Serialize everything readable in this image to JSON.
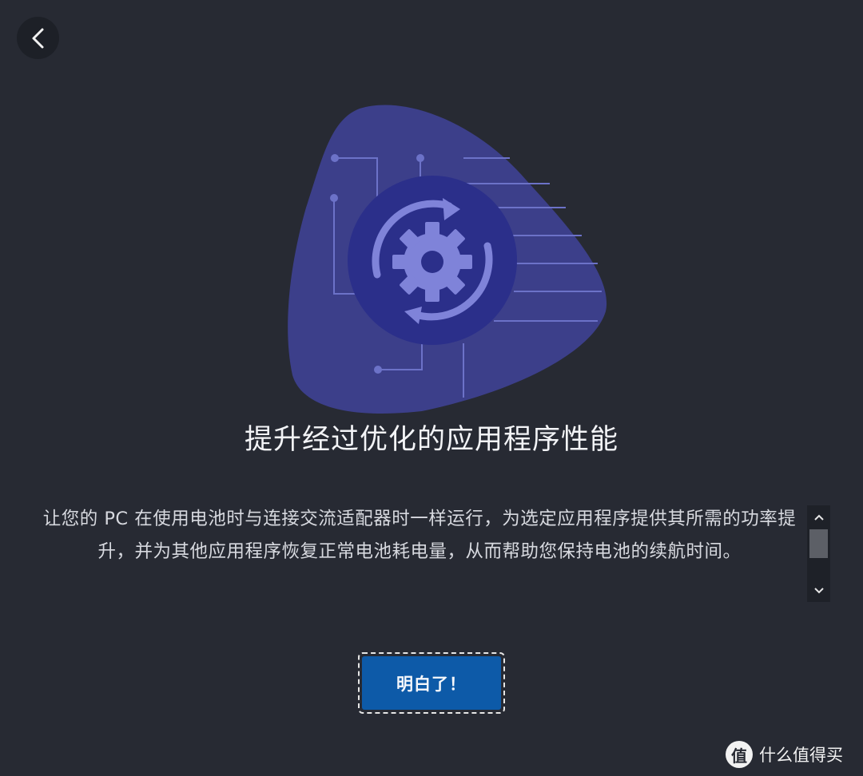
{
  "nav": {
    "back_icon": "chevron-left-icon"
  },
  "hero": {
    "icon": "gear-sync-icon",
    "colors": {
      "blob": "#3c3f8a",
      "disk": "#2b2f8a",
      "gear": "#7f83d9",
      "circuit": "#6c72c8"
    }
  },
  "title": "提升经过优化的应用程序性能",
  "description": "让您的 PC 在使用电池时与连接交流适配器时一样运行，为选定应用程序提供其所需的功率提升，并为其他应用程序恢复正常电池耗电量，从而帮助您保持电池的续航时间。",
  "scrollbar": {
    "up_icon": "chevron-up-icon",
    "down_icon": "chevron-down-icon",
    "position": 0.0
  },
  "confirm_button": {
    "label": "明白了！",
    "color": "#0d5aa8"
  },
  "watermark": {
    "logo_text": "值",
    "text": "什么值得买"
  },
  "theme": {
    "background": "#272a33"
  }
}
